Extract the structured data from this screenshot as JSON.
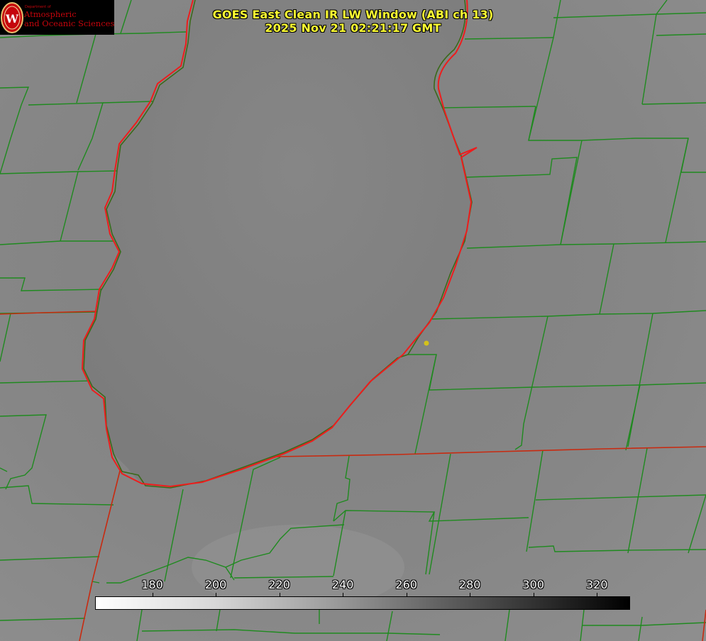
{
  "title": {
    "line1": "GOES East Clean IR LW Window (ABI ch 13)",
    "line2": "2025 Nov 21 02:21:17 GMT"
  },
  "logo": {
    "dept": "Department of",
    "line1": "Atmospheric",
    "line2": "and Oceanic Sciences",
    "seal_letter": "W"
  },
  "colorbar": {
    "ticks": [
      "180",
      "200",
      "220",
      "240",
      "260",
      "280",
      "300",
      "320"
    ],
    "range": [
      162,
      330
    ]
  },
  "colors": {
    "county_lines": "#1f8a1f",
    "state_lines": "#d02010",
    "lake_outline": "#ee1c1c",
    "marker": "#d4c21a",
    "title_text": "#ffff33"
  }
}
